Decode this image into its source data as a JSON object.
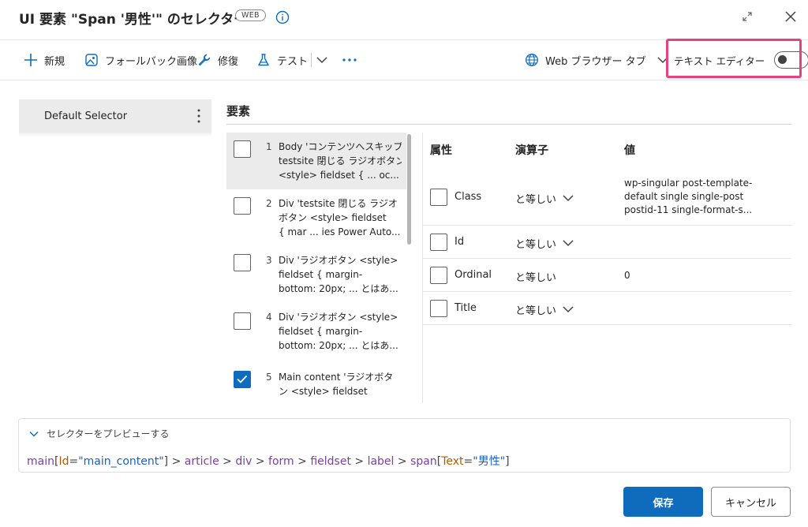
{
  "dialog": {
    "title": "UI 要素 \"Span '男性'\" のセレクター",
    "badge": "WEB"
  },
  "toolbar": {
    "new_label": "新規",
    "fallback_label": "フォールバック画像",
    "repair_label": "修復",
    "test_label": "テスト",
    "browser_tab_label": "Web ブラウザー タブ",
    "text_editor_label": "テキスト エディター",
    "text_editor_enabled": false
  },
  "selectors": [
    {
      "label": "Default Selector"
    }
  ],
  "elements": {
    "title": "要素",
    "items": [
      {
        "num": "1",
        "lines": [
          "Body 'コンテンツへスキップ",
          "testsite 閉じる ラジオボタン",
          "<style> fieldset { ... oc..."
        ],
        "checked": false,
        "selected": true
      },
      {
        "num": "2",
        "lines": [
          "Div 'testsite 閉じる ラジオ",
          "ボタン <style> fieldset",
          "{ mar ... ies Power Auto..."
        ],
        "checked": false,
        "selected": false
      },
      {
        "num": "3",
        "lines": [
          "Div 'ラジオボタン <style>",
          "fieldset { margin-",
          "bottom: 20px; ... とはあ..."
        ],
        "checked": false,
        "selected": false
      },
      {
        "num": "4",
        "lines": [
          "Div 'ラジオボタン <style>",
          "fieldset { margin-",
          "bottom: 20px; ... とはあ..."
        ],
        "checked": false,
        "selected": false
      },
      {
        "num": "5",
        "lines": [
          "Main content 'ラジオボタ",
          "ン <style> fieldset",
          ""
        ],
        "checked": true,
        "selected": false
      }
    ]
  },
  "attributes": {
    "headers": {
      "attribute": "属性",
      "operator": "演算子",
      "value": "値"
    },
    "rows": [
      {
        "name": "Class",
        "operator": "と等しい",
        "has_dropdown": true,
        "value_lines": [
          "wp-singular post-template-",
          "default single single-post",
          "postid-11 single-format-s..."
        ]
      },
      {
        "name": "Id",
        "operator": "と等しい",
        "has_dropdown": true,
        "value_lines": []
      },
      {
        "name": "Ordinal",
        "operator": "と等しい",
        "has_dropdown": false,
        "value_lines": [
          "0"
        ]
      },
      {
        "name": "Title",
        "operator": "と等しい",
        "has_dropdown": true,
        "value_lines": []
      }
    ]
  },
  "preview": {
    "toggle_label": "セレクターをプレビューする",
    "tokens": [
      {
        "text": "main",
        "kind": "tag"
      },
      {
        "text": "[",
        "kind": "op"
      },
      {
        "text": "Id",
        "kind": "attr"
      },
      {
        "text": "=",
        "kind": "op"
      },
      {
        "text": "\"main_content\"",
        "kind": "str"
      },
      {
        "text": "] > ",
        "kind": "op"
      },
      {
        "text": "article",
        "kind": "tag"
      },
      {
        "text": " > ",
        "kind": "op"
      },
      {
        "text": "div",
        "kind": "tag"
      },
      {
        "text": " > ",
        "kind": "op"
      },
      {
        "text": "form",
        "kind": "tag"
      },
      {
        "text": " > ",
        "kind": "op"
      },
      {
        "text": "fieldset",
        "kind": "tag"
      },
      {
        "text": " > ",
        "kind": "op"
      },
      {
        "text": "label",
        "kind": "tag"
      },
      {
        "text": " > ",
        "kind": "op"
      },
      {
        "text": "span",
        "kind": "tag"
      },
      {
        "text": "[",
        "kind": "op"
      },
      {
        "text": "Text",
        "kind": "attr"
      },
      {
        "text": "=",
        "kind": "op"
      },
      {
        "text": "\"男性\"",
        "kind": "str"
      },
      {
        "text": "]",
        "kind": "op"
      }
    ]
  },
  "footer": {
    "save_label": "保存",
    "cancel_label": "キャンセル"
  },
  "colors": {
    "accent": "#0f6cbd",
    "highlight": "#e8417f",
    "tag": "#7a3fa0",
    "attr": "#b25c00",
    "string": "#1a5fc4"
  }
}
